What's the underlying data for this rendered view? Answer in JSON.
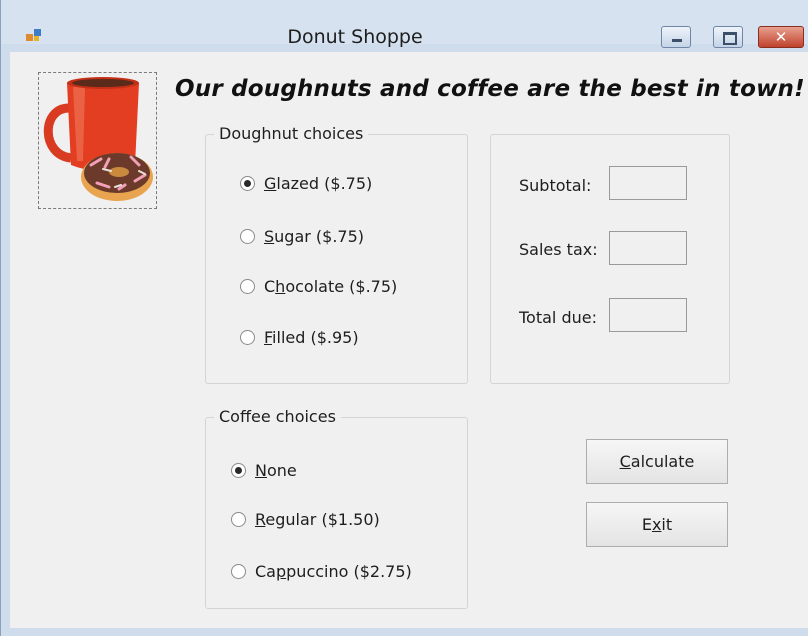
{
  "window": {
    "title": "Donut Shoppe",
    "close_glyph": "✕"
  },
  "headline": "Our doughnuts and coffee are the best in town!",
  "image": {
    "icon": "coffee-mug-and-donut"
  },
  "doughnut_group": {
    "legend": "Doughnut choices",
    "options": [
      {
        "mnemonic": "G",
        "rest": "lazed ($.75)",
        "checked": true
      },
      {
        "mnemonic": "S",
        "rest": "ugar ($.75)",
        "checked": false
      },
      {
        "prefix": "C",
        "mnemonic": "h",
        "rest": "ocolate ($.75)",
        "checked": false
      },
      {
        "mnemonic": "F",
        "rest": "illed ($.95)",
        "checked": false
      }
    ]
  },
  "coffee_group": {
    "legend": "Coffee choices",
    "options": [
      {
        "mnemonic": "N",
        "rest": "one",
        "checked": true
      },
      {
        "mnemonic": "R",
        "rest": "egular ($1.50)",
        "checked": false
      },
      {
        "prefix": "Ca",
        "mnemonic": "p",
        "rest": "puccino ($2.75)",
        "checked": false
      }
    ]
  },
  "totals": {
    "subtotal_label": "Subtotal:",
    "subtotal_value": "",
    "tax_label": "Sales tax:",
    "tax_value": "",
    "total_label": "Total due:",
    "total_value": ""
  },
  "buttons": {
    "calculate": {
      "mnemonic": "C",
      "rest": "alculate"
    },
    "exit": {
      "prefix": "E",
      "mnemonic": "x",
      "rest": "it"
    }
  },
  "colors": {
    "title_bar": "#d6e2f0",
    "close_button": "#c0422c",
    "form_background": "#f0f0f0"
  }
}
